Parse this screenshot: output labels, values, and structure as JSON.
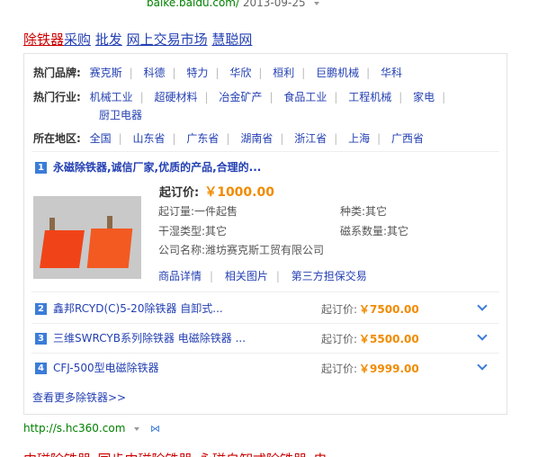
{
  "top_url": {
    "domain": "baike.baidu.com/",
    "date": "2013-09-25"
  },
  "result_title": {
    "highlight": "除铁器",
    "rest": [
      "采购",
      "批发",
      "网上交易市场",
      "慧聪网"
    ]
  },
  "filters": {
    "brands": {
      "label": "热门品牌:",
      "items": [
        "赛克斯",
        "科德",
        "特力",
        "华欣",
        "桓利",
        "巨鹏机械",
        "华科"
      ]
    },
    "industries": {
      "label": "热门行业:",
      "items": [
        "机械工业",
        "超硬材料",
        "冶金矿产",
        "食品工业",
        "工程机械",
        "家电"
      ],
      "wrap_item": "厨卫电器"
    },
    "regions": {
      "label": "所在地区:",
      "items": [
        "全国",
        "山东省",
        "广东省",
        "湖南省",
        "浙江省",
        "上海",
        "广西省"
      ]
    }
  },
  "item1": {
    "num": "1",
    "title": "永磁除铁器,诚信厂家,优质的产品,合理的...",
    "price_label": "起订价:",
    "price_value": "￥1000.00",
    "attrs": {
      "moq": "起订量:一件起售",
      "kind": "种类:其它",
      "wetdry": "干湿类型:其它",
      "magnets": "磁系数量:其它",
      "company": "公司名称:潍坊赛克斯工贸有限公司"
    },
    "links": [
      "商品详情",
      "相关图片",
      "第三方担保交易"
    ]
  },
  "items": [
    {
      "num": "2",
      "title": "鑫邦RCYD(C)5-20除铁器 自卸式...",
      "price_label": "起订价:",
      "price_value": "￥7500.00"
    },
    {
      "num": "3",
      "title": "三维SWRCYB系列除铁器 电磁除铁器 ...",
      "price_label": "起订价:",
      "price_value": "￥5500.00"
    },
    {
      "num": "4",
      "title": "CFJ-500型电磁除铁器",
      "price_label": "起订价:",
      "price_value": "￥9999.00"
    }
  ],
  "more_link": "查看更多除铁器>>",
  "bottom_url": "http://s.hc360.com",
  "next_title": "内磁除铁器_同步内磁除铁器_永磁自卸式除铁器_电..."
}
